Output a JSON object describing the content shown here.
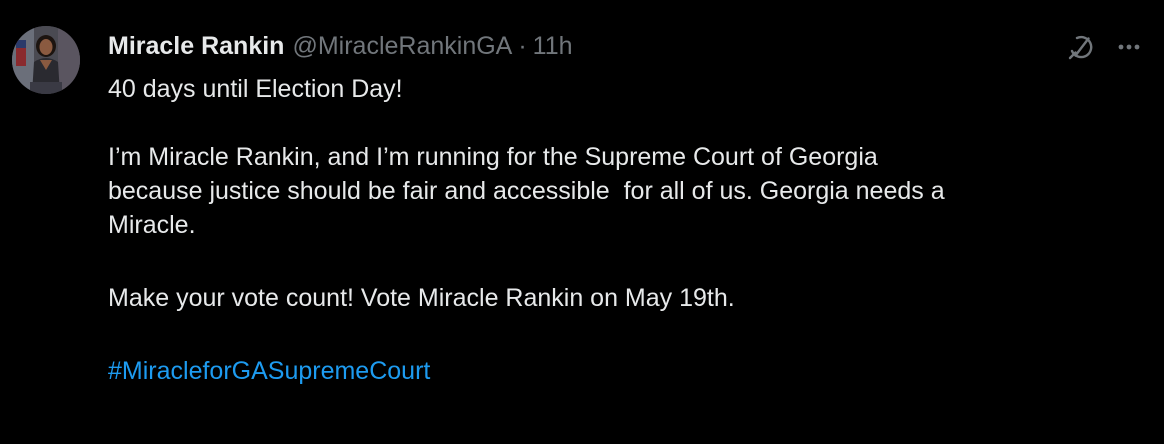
{
  "author": {
    "display_name": "Miracle Rankin",
    "handle": "@MiracleRankinGA",
    "separator": "·",
    "time": "11h",
    "avatar_alt": "Miracle Rankin profile photo"
  },
  "actions": {
    "grok_icon": "grok-icon",
    "more_icon": "more-icon"
  },
  "tweet": {
    "line1": "40 days until Election Day!",
    "para2_line1": "I’m Miracle Rankin, and I’m running for the Supreme Court of Georgia",
    "para2_line2": "because justice should be fair and accessible  for all of us. Georgia needs a",
    "para2_line3": "Miracle.",
    "para3": "Make your vote count! Vote Miracle Rankin on May 19th.",
    "hashtag": "#MiracleforGASupremeCourt"
  },
  "colors": {
    "background": "#000000",
    "text": "#e7e9ea",
    "secondary": "#71767b",
    "link": "#1d9bf0"
  }
}
